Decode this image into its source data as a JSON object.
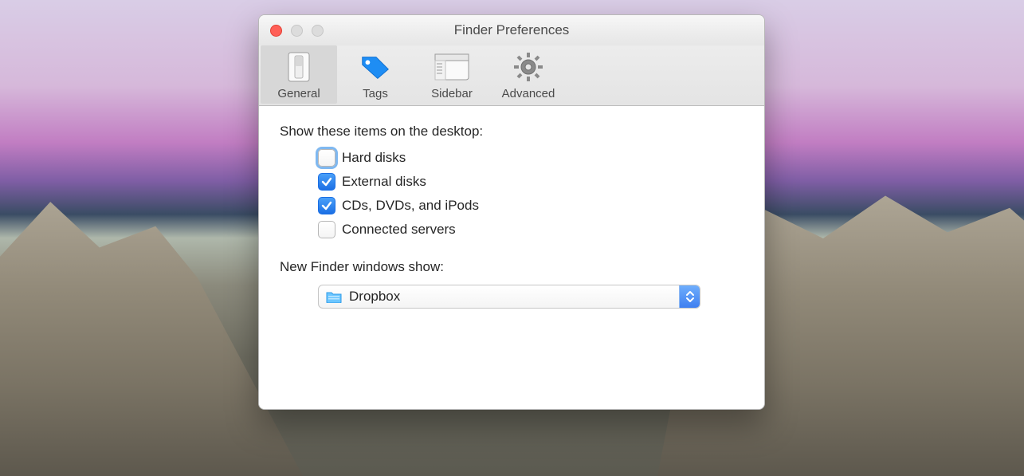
{
  "window": {
    "title": "Finder Preferences"
  },
  "toolbar": {
    "items": [
      {
        "id": "general",
        "label": "General",
        "active": true,
        "icon": "switch-icon"
      },
      {
        "id": "tags",
        "label": "Tags",
        "active": false,
        "icon": "tag-icon"
      },
      {
        "id": "sidebar",
        "label": "Sidebar",
        "active": false,
        "icon": "sidebar-icon"
      },
      {
        "id": "advanced",
        "label": "Advanced",
        "active": false,
        "icon": "gear-icon"
      }
    ]
  },
  "general": {
    "desktop_items_label": "Show these items on the desktop:",
    "desktop_items": [
      {
        "id": "hard-disks",
        "label": "Hard disks",
        "checked": false,
        "focused": true
      },
      {
        "id": "external-disks",
        "label": "External disks",
        "checked": true,
        "focused": false
      },
      {
        "id": "cds-dvds-ipods",
        "label": "CDs, DVDs, and iPods",
        "checked": true,
        "focused": false
      },
      {
        "id": "connected-servers",
        "label": "Connected servers",
        "checked": false,
        "focused": false
      }
    ],
    "new_window_label": "New Finder windows show:",
    "new_window_value": "Dropbox"
  },
  "colors": {
    "accent": "#2e7cf6",
    "tag_blue": "#1e8df4"
  }
}
